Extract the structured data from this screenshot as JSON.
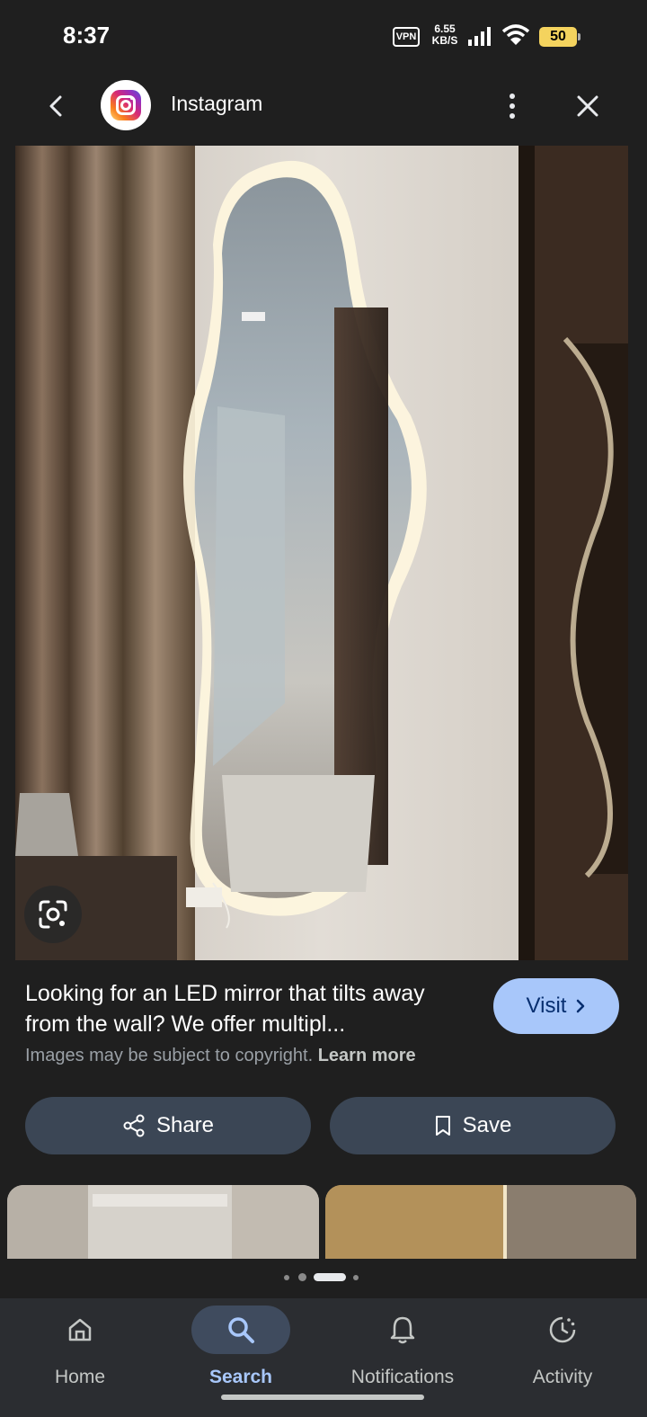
{
  "status_bar": {
    "time": "8:37",
    "vpn": "VPN",
    "speed_value": "6.55",
    "speed_unit": "KB/S",
    "battery": "50",
    "battery_color": "#f4d35e"
  },
  "app_bar": {
    "source_name": "Instagram",
    "source_icon": "instagram-logo",
    "back_icon": "back-arrow-icon",
    "more_icon": "more-vert-icon",
    "close_icon": "close-icon"
  },
  "result": {
    "title": "Looking for an LED mirror that tilts away from the wall? We offer multipl...",
    "visit_label": "Visit",
    "copyright_text": "Images may be subject to copyright.",
    "learn_more": "Learn more",
    "accent_color": "#a8c7fa"
  },
  "actions": {
    "share_label": "Share",
    "save_label": "Save"
  },
  "bottom_nav": {
    "items": [
      {
        "label": "Home",
        "icon": "home-icon",
        "active": false
      },
      {
        "label": "Search",
        "icon": "search-icon",
        "active": true
      },
      {
        "label": "Notifications",
        "icon": "bell-icon",
        "active": false
      },
      {
        "label": "Activity",
        "icon": "activity-icon",
        "active": false
      }
    ]
  }
}
